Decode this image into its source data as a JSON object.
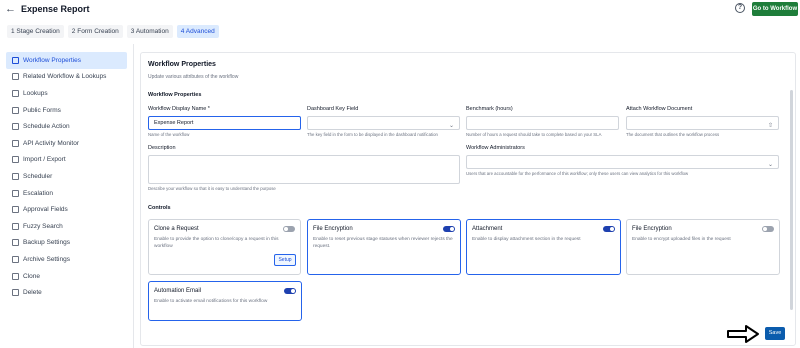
{
  "header": {
    "back_icon": "arrow-left-icon",
    "title": "Expense Report",
    "help_icon": "help-circle-icon",
    "help_glyph": "?",
    "go_to_workflow": "Go to Workflow"
  },
  "tabs": [
    {
      "label": "1  Stage Creation"
    },
    {
      "label": "2  Form Creation"
    },
    {
      "label": "3  Automation"
    },
    {
      "label": "4  Advanced"
    }
  ],
  "sidebar": {
    "items": [
      {
        "label": "Workflow Properties",
        "active": true
      },
      {
        "label": "Related Workflow & Lookups"
      },
      {
        "label": "Lookups"
      },
      {
        "label": "Public Forms"
      },
      {
        "label": "Schedule Action"
      },
      {
        "label": "API Activity Monitor"
      },
      {
        "label": "Import / Export"
      },
      {
        "label": "Scheduler"
      },
      {
        "label": "Escalation"
      },
      {
        "label": "Approval Fields"
      },
      {
        "label": "Fuzzy Search"
      },
      {
        "label": "Backup Settings"
      },
      {
        "label": "Archive Settings"
      },
      {
        "label": "Clone"
      },
      {
        "label": "Delete"
      }
    ]
  },
  "main": {
    "title": "Workflow Properties",
    "subtitle": "Update various attributes of the workflow",
    "section_properties": "Workflow Properties",
    "fields": {
      "display_name": {
        "label": "Workflow Display Name *",
        "value": "Expense Report",
        "help": "Name of the workflow"
      },
      "dashboard_key": {
        "label": "Dashboard Key Field",
        "value": "",
        "help": "The key field in the form to be displayed in the dashboard notification"
      },
      "benchmark": {
        "label": "Benchmark (hours)",
        "value": "",
        "help": "Number of hours a request should take to complete based on your SLA"
      },
      "attach_doc": {
        "label": "Attach Workflow Document",
        "value": "",
        "help": "The document that outlines the workflow process"
      },
      "description": {
        "label": "Description",
        "value": "",
        "help": "Describe your workflow so that it is easy to understand the purpose"
      },
      "administrators": {
        "label": "Workflow Administrators",
        "value": "",
        "help": "Users that are accountable for the performance of this workflow; only these users can view analytics for this workflow"
      }
    },
    "section_controls": "Controls",
    "controls": [
      {
        "title": "Clone a Request",
        "desc": "Enable to provide the option to clone/copy a request in this workflow",
        "enabled": false,
        "button": "Setup"
      },
      {
        "title": "File Encryption",
        "desc": "Enable to reset previous stage statuses when reviewer rejects the request.",
        "enabled": true
      },
      {
        "title": "Attachment",
        "desc": "Enable to display attachment section in the request",
        "enabled": true
      },
      {
        "title": "File Encryption",
        "desc": "Enable to encrypt uploaded files in the request",
        "enabled": false
      },
      {
        "title": "Automation Email",
        "desc": "Enable to activate email notifications for this workflow",
        "enabled": true
      }
    ]
  },
  "footer": {
    "save": "Save",
    "pointer_icon": "arrow-right-icon"
  },
  "colors": {
    "primary": "#0b5cad",
    "success": "#1e7d3a",
    "active_bg": "#dbeafe"
  }
}
